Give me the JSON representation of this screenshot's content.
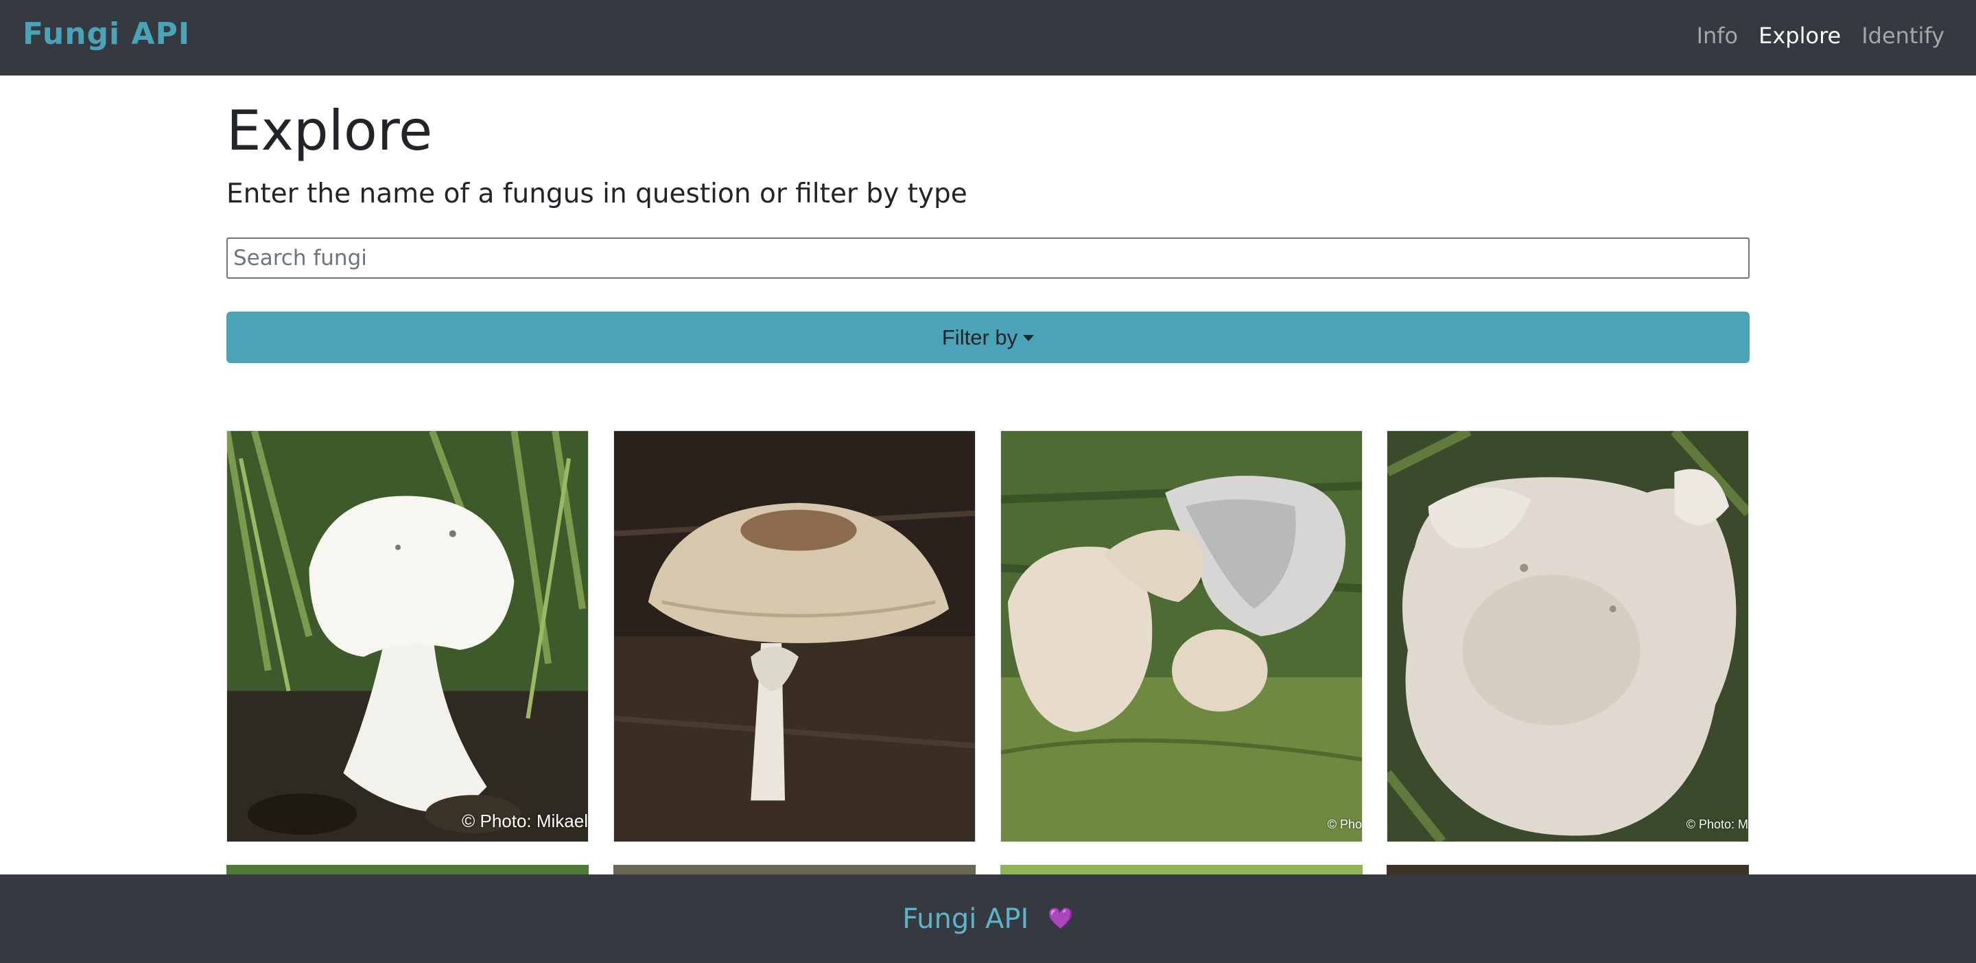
{
  "navbar": {
    "brand": "Fungi API",
    "links": [
      {
        "label": "Info",
        "active": false
      },
      {
        "label": "Explore",
        "active": true
      },
      {
        "label": "Identify",
        "active": false
      }
    ]
  },
  "main": {
    "title": "Explore",
    "subtitle": "Enter the name of a fungus in question or filter by type",
    "search": {
      "placeholder": "Search fungi",
      "value": ""
    },
    "filter_button": {
      "label": "Filter by"
    }
  },
  "cards": [
    {
      "credit": "© Photo: Mikael"
    },
    {
      "credit": ""
    },
    {
      "credit": "© Pho"
    },
    {
      "credit": "© Photo: M"
    }
  ],
  "footer": {
    "brand": "Fungi API",
    "heart": "💜"
  },
  "colors": {
    "navbar": "#343a40",
    "accent": "#4aa3b7",
    "active_link": "#ffffff"
  }
}
